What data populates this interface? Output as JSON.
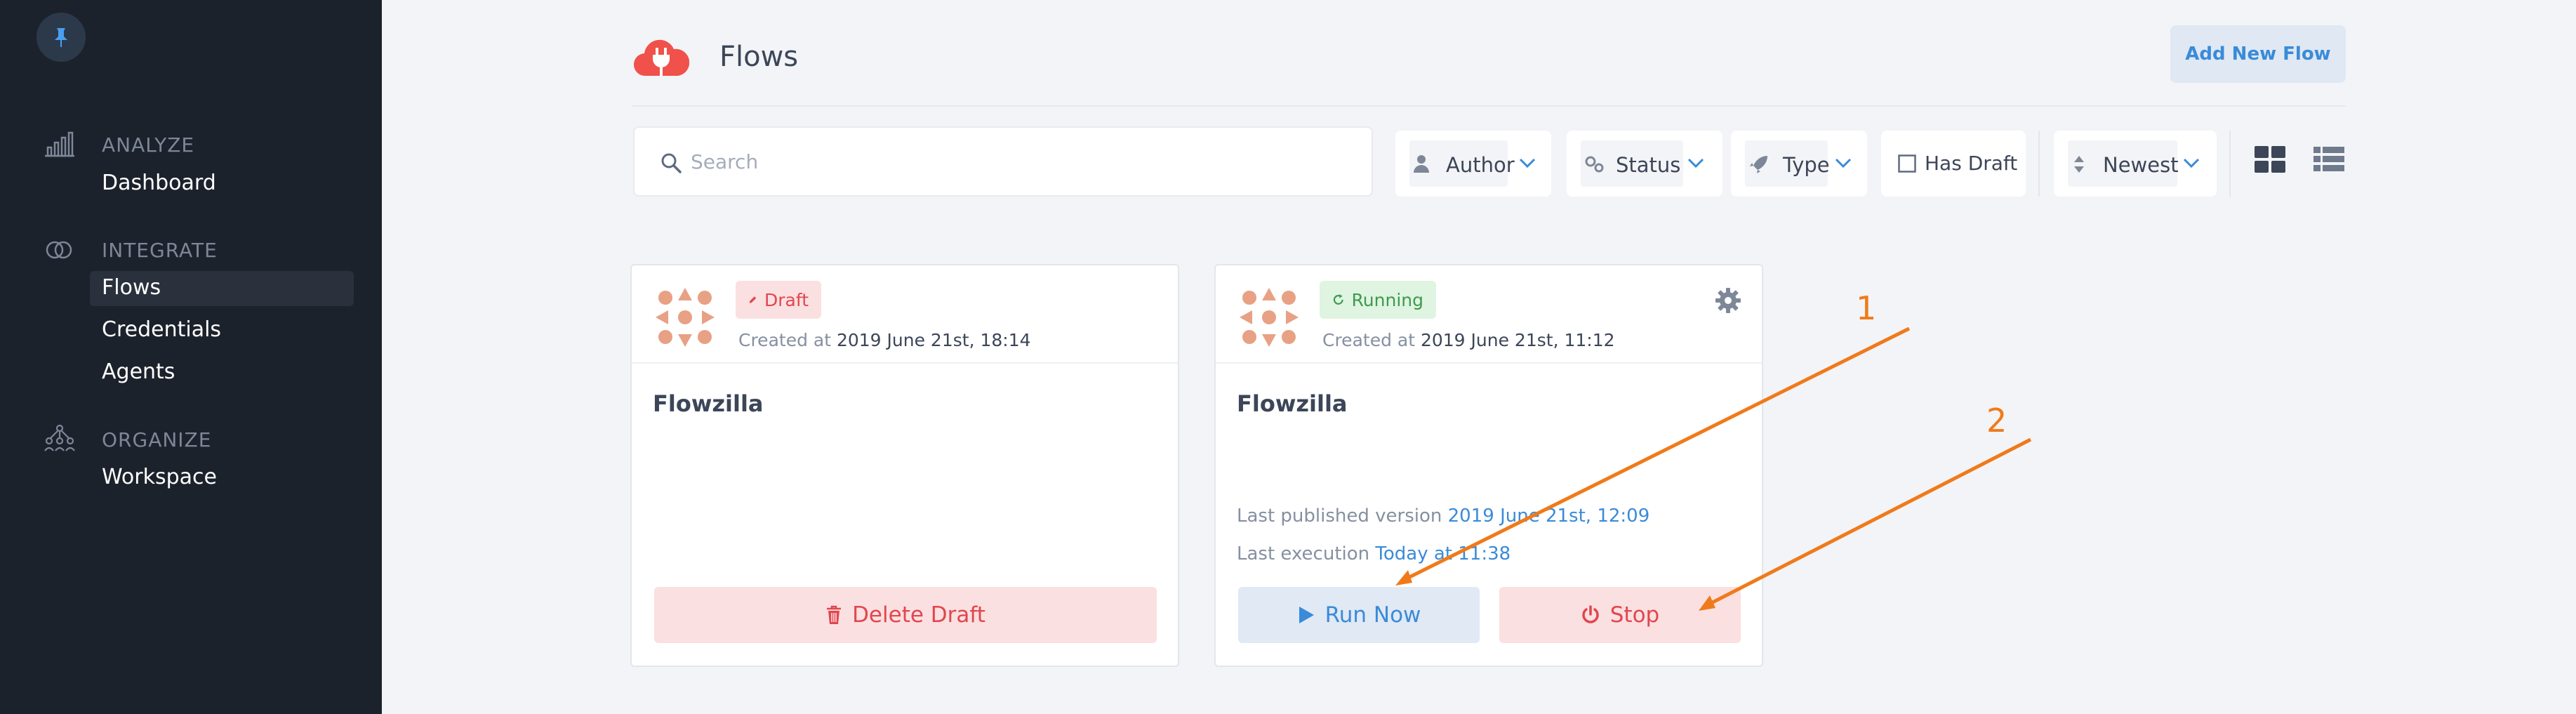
{
  "sidebar": {
    "sections": [
      {
        "heading": "ANALYZE",
        "items": [
          {
            "label": "Dashboard"
          }
        ]
      },
      {
        "heading": "INTEGRATE",
        "items": [
          {
            "label": "Flows"
          },
          {
            "label": "Credentials"
          },
          {
            "label": "Agents"
          }
        ]
      },
      {
        "heading": "ORGANIZE",
        "items": [
          {
            "label": "Workspace"
          }
        ]
      }
    ],
    "active_item": "Flows"
  },
  "header": {
    "title": "Flows",
    "add_button": "Add New Flow"
  },
  "filters": {
    "search_placeholder": "Search",
    "author": "Author",
    "status": "Status",
    "type": "Type",
    "has_draft": "Has Draft",
    "has_draft_checked": false,
    "sort": "Newest"
  },
  "cards": [
    {
      "badge": "Draft",
      "created_label": "Created at",
      "created_value": "2019 June 21st, 18:14",
      "title": "Flowzilla",
      "action": "Delete Draft"
    },
    {
      "badge": "Running",
      "created_label": "Created at",
      "created_value": "2019 June 21st, 11:12",
      "title": "Flowzilla",
      "published_label": "Last published version",
      "published_value": "2019 June 21st, 12:09",
      "execution_label": "Last execution",
      "execution_value": "Today at 11:38",
      "run_label": "Run Now",
      "stop_label": "Stop"
    }
  ],
  "annotations": [
    "1",
    "2"
  ],
  "colors": {
    "sidebar_bg": "#1c222c",
    "accent_blue": "#3a8bd8",
    "danger": "#e2464e",
    "success": "#3f9a4d",
    "annotation": "#f07a1a"
  }
}
